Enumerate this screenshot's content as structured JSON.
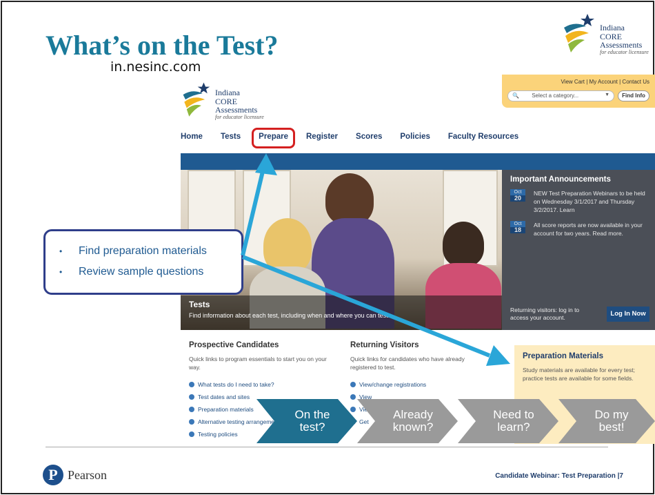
{
  "slide": {
    "title": "What’s on the Test?",
    "url": "in.nesinc.com",
    "footer_note": "Candidate Webinar: Test Preparation |7",
    "brand": "Pearson"
  },
  "logo": {
    "line1": "Indiana",
    "line2": "CORE",
    "line3": "Assessments",
    "tagline": "for educator licensure"
  },
  "site": {
    "utility_links": "View Cart | My Account | Contact Us",
    "search_placeholder": "Select a category...",
    "find_button": "Find Info",
    "nav": [
      "Home",
      "Tests",
      "Prepare",
      "Register",
      "Scores",
      "Policies",
      "Faculty Resources"
    ],
    "hero": {
      "title": "Tests",
      "text": "Find information about each test, including when and where you can test."
    },
    "announcements": {
      "title": "Important Announcements",
      "items": [
        {
          "month": "Oct",
          "day": "20",
          "text": "NEW Test Preparation Webinars to be held on Wednesday 3/1/2017 and Thursday 3/2/2017. Learn"
        },
        {
          "month": "Oct",
          "day": "18",
          "text": "All score reports are now available in your account for two years. Read more."
        }
      ],
      "returning": "Returning visitors: log in to access your account.",
      "login_button": "Log In Now"
    },
    "prospective": {
      "title": "Prospective Candidates",
      "text": "Quick links to program essentials to start you on your way.",
      "links": [
        "What tests do I need to take?",
        "Test dates and sites",
        "Preparation materials",
        "Alternative testing arrangements",
        "Testing policies"
      ]
    },
    "returning": {
      "title": "Returning Visitors",
      "text": "Quick links for candidates who have already registered to test.",
      "links": [
        "View/change registrations",
        "View",
        "View",
        "Get"
      ]
    },
    "preparation": {
      "title": "Preparation Materials",
      "text": "Study materials are available for every test; practice tests are available for some fields."
    }
  },
  "callout": {
    "items": [
      "Find preparation materials",
      "Review sample questions"
    ]
  },
  "steps": [
    {
      "label": "On the\ntest?",
      "color": "#1f6f8f"
    },
    {
      "label": "Already\nknown?",
      "color": "#9a9a9a"
    },
    {
      "label": "Need to\nlearn?",
      "color": "#9a9a9a"
    },
    {
      "label": "Do my\nbest!",
      "color": "#9a9a9a"
    }
  ],
  "colors": {
    "title": "#1a7a9a",
    "arrow": "#2aa6d8",
    "highlight": "#d42020",
    "nav_band": "#1f5a91"
  }
}
